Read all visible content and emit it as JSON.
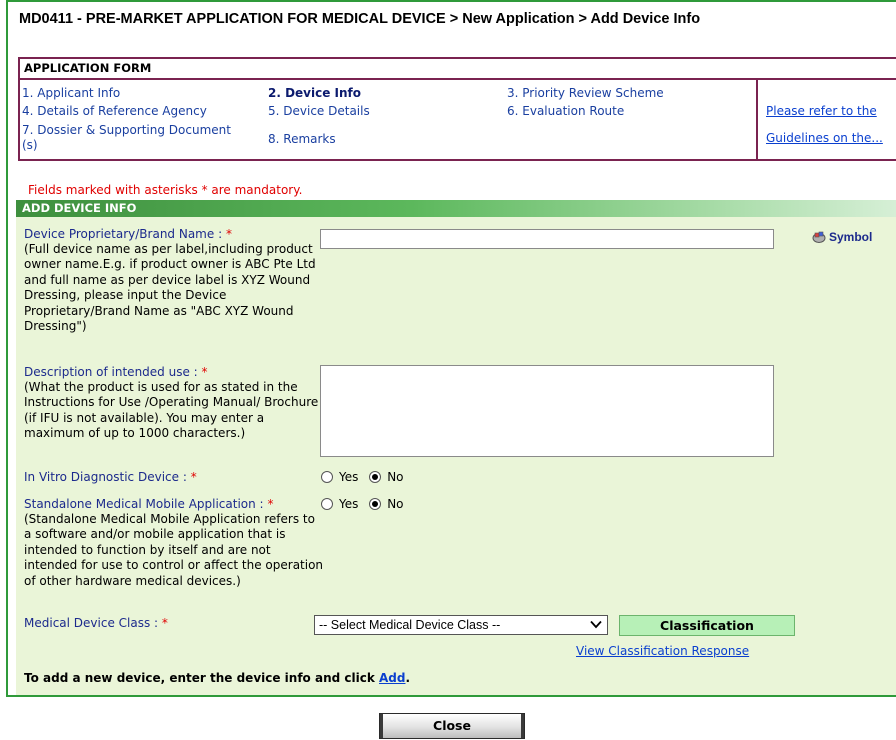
{
  "page_title": "MD0411 - PRE-MARKET APPLICATION FOR MEDICAL DEVICE > New Application > Add Device Info",
  "application_form": {
    "header": "APPLICATION FORM",
    "steps": [
      {
        "label": "1. Applicant Info",
        "active": false
      },
      {
        "label": "2. Device Info",
        "active": true
      },
      {
        "label": "3. Priority Review Scheme",
        "active": false
      },
      {
        "label": "4. Details of Reference Agency",
        "active": false
      },
      {
        "label": "5. Device Details",
        "active": false
      },
      {
        "label": "6. Evaluation Route",
        "active": false
      },
      {
        "label": "7. Dossier & Supporting Document",
        "label_cont": "(s)",
        "active": false
      },
      {
        "label": "8. Remarks",
        "active": false
      }
    ],
    "guidelines_link_1": "Please refer to the",
    "guidelines_link_2": "Guidelines on the..."
  },
  "mandatory_note": "Fields marked with asterisks * are mandatory.",
  "section_title": "ADD DEVICE INFO",
  "fields": {
    "brand_name": {
      "label": "Device Proprietary/Brand Name :",
      "required": "*",
      "note": "(Full device name as per label,including product owner name.E.g. if product owner is ABC Pte Ltd and full name as per device label is XYZ Wound Dressing, please input the Device Proprietary/Brand Name as \"ABC XYZ Wound Dressing\")",
      "value": ""
    },
    "symbol_label": "Symbol",
    "intended_use": {
      "label": "Description of intended use :",
      "required": "*",
      "note": "(What the product is used for as stated in the Instructions for Use /Operating Manual/ Brochure (if IFU is not available). You may enter a maximum of up to 1000 characters.)",
      "value": ""
    },
    "ivd": {
      "label": "In Vitro Diagnostic Device :",
      "required": "*",
      "options": [
        "Yes",
        "No"
      ],
      "selected": "No"
    },
    "mobile_app": {
      "label": "Standalone Medical Mobile Application :",
      "required": "*",
      "note": "(Standalone Medical Mobile Application refers to a software and/or mobile application that is intended to function by itself and are not intended for use to control or affect the operation of other hardware medical devices.)",
      "options": [
        "Yes",
        "No"
      ],
      "selected": "No"
    },
    "device_class": {
      "label": "Medical Device Class :",
      "required": "*",
      "selected": "-- Select Medical Device Class --"
    }
  },
  "classification_button": "Classification",
  "view_classification_link": "View Classification Response",
  "add_instruction_prefix": "To add a new device, enter the device info and click ",
  "add_link": "Add",
  "add_instruction_suffix": ".",
  "close_button": "Close",
  "colors": {
    "frame_border": "#2f9a3a",
    "form_border": "#7a2350",
    "form_bg": "#eaf5d8",
    "label_color": "#1c2a8c",
    "required_color": "#e00000",
    "link_color": "#0a3fcf",
    "classify_bg": "#b7f0b7"
  }
}
